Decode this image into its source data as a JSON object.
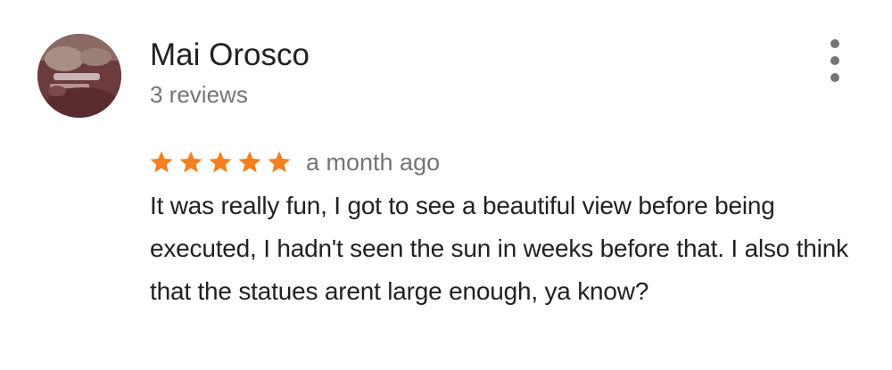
{
  "review": {
    "author": "Mai Orosco",
    "review_count": "3 reviews",
    "rating": 5,
    "max_rating": 5,
    "time_ago": "a month ago",
    "text": "It was really fun, I got to see a beautiful view before being executed, I hadn't seen the sun in weeks before that. I also think that the statues arent large enough, ya know?"
  },
  "icons": {
    "star": "star-icon",
    "more": "more-vert-icon",
    "avatar": "avatar"
  },
  "colors": {
    "star": "#f4801f",
    "text_primary": "#212121",
    "text_secondary": "#757575"
  }
}
